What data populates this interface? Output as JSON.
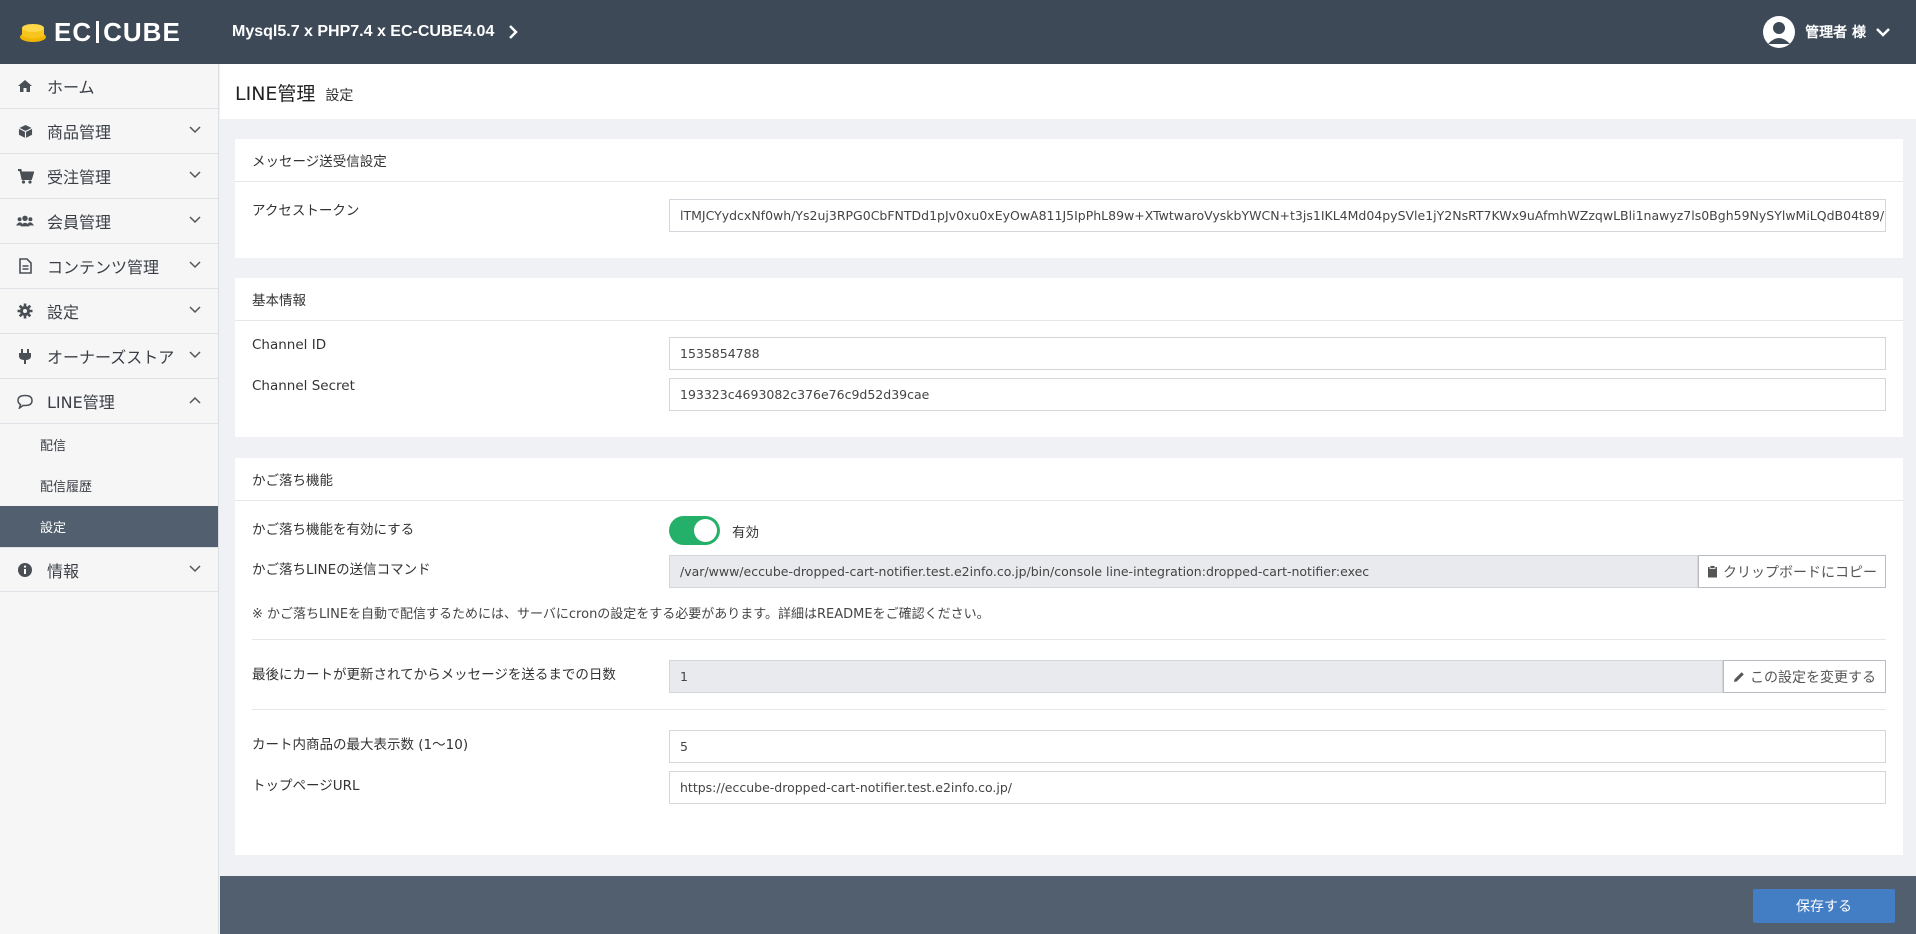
{
  "header": {
    "logo": "EC CUBE",
    "logo_left": "EC",
    "logo_right": "CUBE",
    "shop_name": "Mysql5.7 x PHP7.4 x EC-CUBE4.04",
    "user": "管理者 様"
  },
  "sidebar": {
    "items": [
      {
        "label": "ホーム",
        "icon": "home-icon"
      },
      {
        "label": "商品管理",
        "icon": "cube-icon"
      },
      {
        "label": "受注管理",
        "icon": "cart-icon"
      },
      {
        "label": "会員管理",
        "icon": "users-icon"
      },
      {
        "label": "コンテンツ管理",
        "icon": "file-icon"
      },
      {
        "label": "設定",
        "icon": "gear-icon"
      },
      {
        "label": "オーナーズストア",
        "icon": "plug-icon"
      },
      {
        "label": "LINE管理",
        "icon": "comment-icon"
      }
    ],
    "line_sub": [
      "配信",
      "配信履歴",
      "設定"
    ],
    "info": {
      "label": "情報",
      "icon": "info-icon"
    }
  },
  "page": {
    "title": "LINE管理",
    "subtitle": "設定"
  },
  "message_settings": {
    "heading": "メッセージ送受信設定",
    "access_token_label": "アクセストークン",
    "access_token": "lTMJCYydcxNf0wh/Ys2uj3RPG0CbFNTDd1pJv0xu0xEyOwA811J5IpPhL89w+XTwtwaroVyskbYWCN+t3js1IKL4Md04pySVle1jY2NsRT7KWx9uAfmhWZzqwLBli1nawyz7ls0Bgh59NySYlwMiLQdB04t89/"
  },
  "basic_info": {
    "heading": "基本情報",
    "channel_id_label": "Channel ID",
    "channel_id": "1535854788",
    "channel_secret_label": "Channel Secret",
    "channel_secret": "193323c4693082c376e76c9d52d39cae"
  },
  "dropped_cart": {
    "heading": "かご落ち機能",
    "enable_label": "かご落ち機能を有効にする",
    "enable_value": "有効",
    "enabled": true,
    "command_label": "かご落ちLINEの送信コマンド",
    "command": "/var/www/eccube-dropped-cart-notifier.test.e2info.co.jp/bin/console line-integration:dropped-cart-notifier:exec",
    "copy_button": "クリップボードにコピー",
    "note": "※ かご落ちLINEを自動で配信するためには、サーバにcronの設定をする必要があります。詳細はREADMEをご確認ください。",
    "days_label": "最後にカートが更新されてからメッセージを送るまでの日数",
    "days": "1",
    "change_button": "この設定を変更する",
    "max_items_label": "カート内商品の最大表示数 (1〜10)",
    "max_items": "5",
    "top_url_label": "トップページURL",
    "top_url": "https://eccube-dropped-cart-notifier.test.e2info.co.jp/"
  },
  "footer": {
    "save_button": "保存する"
  },
  "colors": {
    "header_bg": "#3d4957",
    "toggle_on": "#25b06a",
    "primary": "#437ec4",
    "active_nav": "#525f6e"
  }
}
